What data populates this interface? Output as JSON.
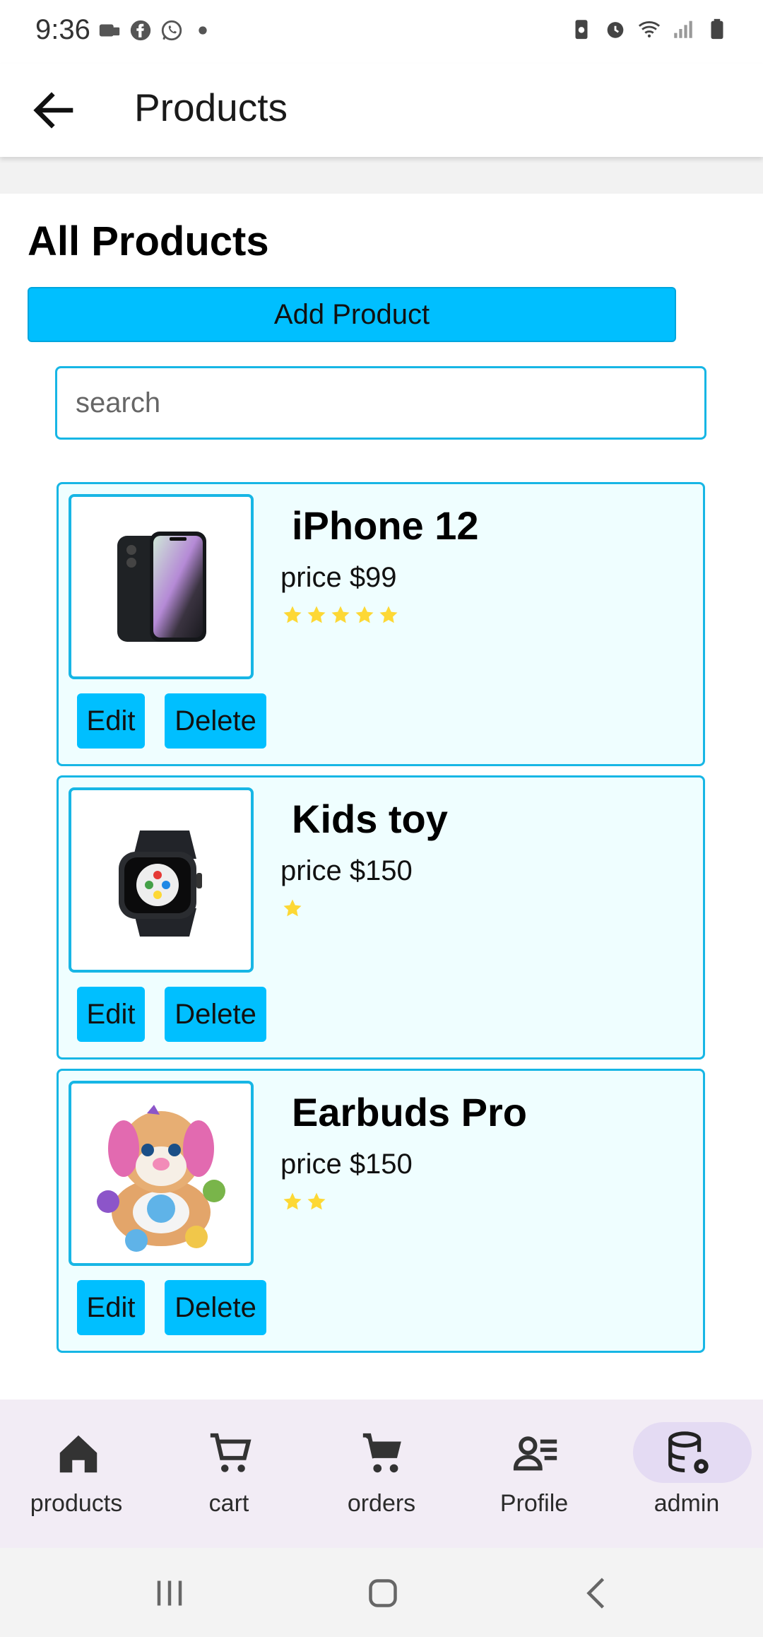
{
  "status": {
    "time": "9:36"
  },
  "appbar": {
    "title": "Products"
  },
  "section": {
    "title": "All Products",
    "add_button": "Add Product"
  },
  "search": {
    "placeholder": "search",
    "value": ""
  },
  "products": [
    {
      "name": "iPhone 12",
      "price": "price $99",
      "rating": 5,
      "image": "iphone-image",
      "edit": "Edit",
      "delete": "Delete"
    },
    {
      "name": "Kids toy",
      "price": "price $150",
      "rating": 1,
      "image": "watch-image",
      "edit": "Edit",
      "delete": "Delete"
    },
    {
      "name": "Earbuds Pro",
      "price": "price $150",
      "rating": 2,
      "image": "plush-toy-image",
      "edit": "Edit",
      "delete": "Delete"
    }
  ],
  "nav": [
    {
      "label": "products",
      "icon": "home-icon"
    },
    {
      "label": "cart",
      "icon": "cart-outline-icon"
    },
    {
      "label": "orders",
      "icon": "cart-filled-icon"
    },
    {
      "label": "Profile",
      "icon": "profile-list-icon"
    },
    {
      "label": "admin",
      "icon": "database-gear-icon",
      "active": true
    }
  ],
  "colors": {
    "accent": "#00bfff",
    "border": "#17b6e5",
    "card_bg": "#effeff",
    "star": "#fdd835",
    "nav_bg": "#f2ecf5",
    "nav_active": "#e4dbf3"
  }
}
